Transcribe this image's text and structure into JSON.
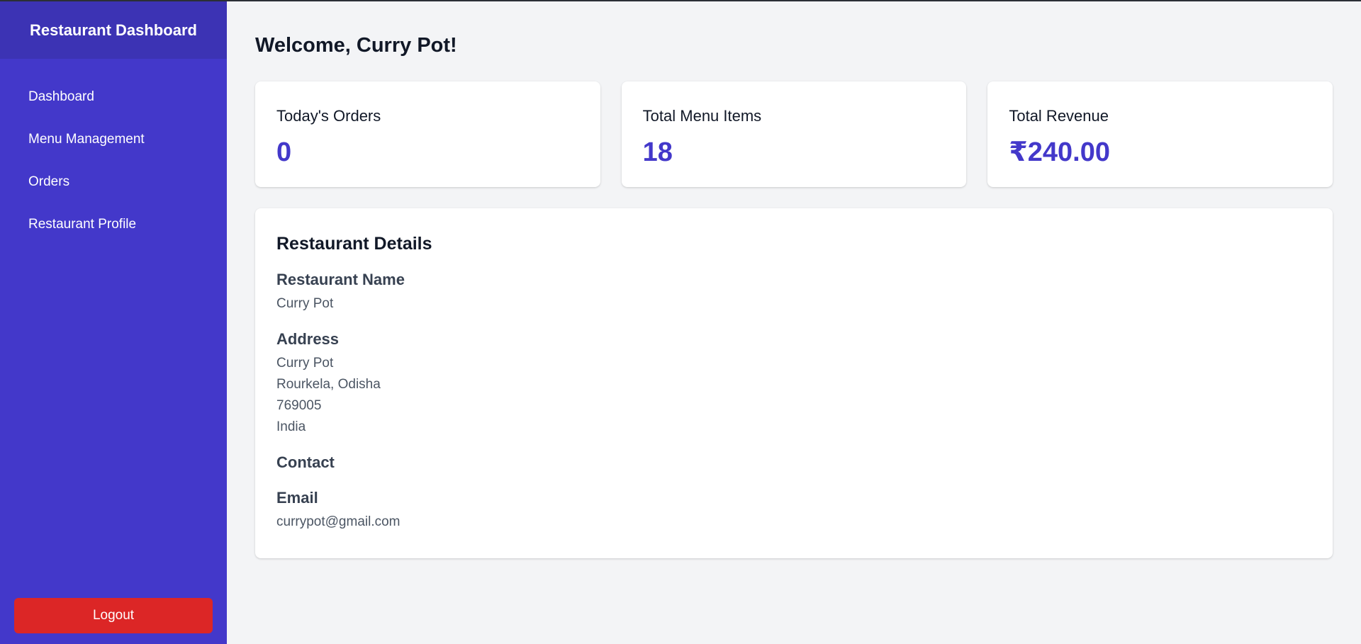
{
  "sidebar": {
    "title": "Restaurant Dashboard",
    "items": [
      {
        "label": "Dashboard"
      },
      {
        "label": "Menu Management"
      },
      {
        "label": "Orders"
      },
      {
        "label": "Restaurant Profile"
      }
    ],
    "logout_label": "Logout"
  },
  "main": {
    "welcome": "Welcome, Curry Pot!",
    "stats": [
      {
        "label": "Today's Orders",
        "value": "0"
      },
      {
        "label": "Total Menu Items",
        "value": "18"
      },
      {
        "label": "Total Revenue",
        "value": "₹240.00"
      }
    ],
    "details": {
      "title": "Restaurant Details",
      "name_label": "Restaurant Name",
      "name_value": "Curry Pot",
      "address_label": "Address",
      "address_lines": [
        "Curry Pot",
        "Rourkela, Odisha",
        "769005",
        "India"
      ],
      "contact_label": "Contact",
      "email_label": "Email",
      "email_value": "currypot@gmail.com"
    }
  },
  "colors": {
    "sidebar_bg": "#4338ca",
    "sidebar_header_bg": "#3c33b4",
    "accent": "#4338ca",
    "logout_bg": "#dc2626",
    "page_bg": "#f3f4f6"
  }
}
